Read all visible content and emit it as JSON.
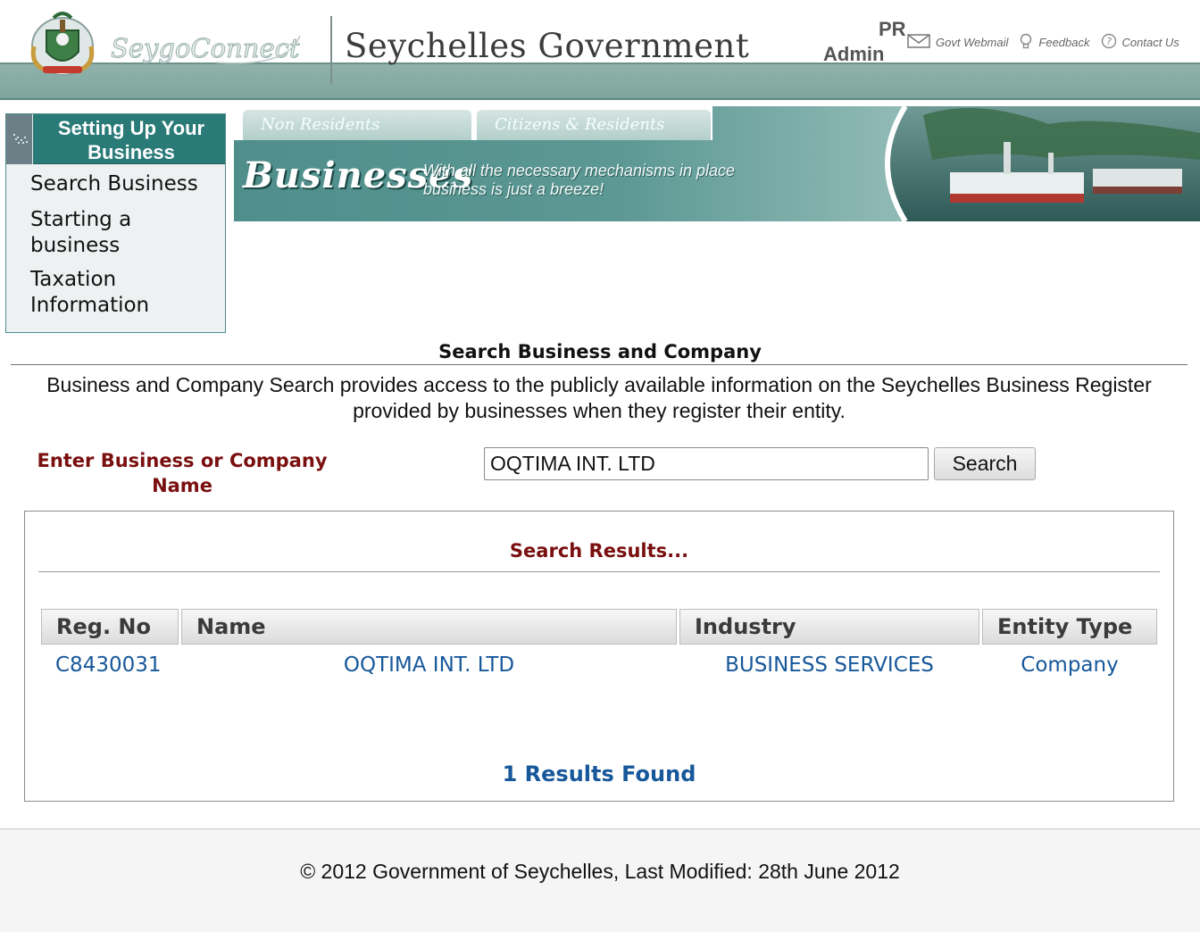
{
  "header": {
    "site_title": "Seychelles Government",
    "brand_logo": "SeygoConnect",
    "user_line1": "PR",
    "user_line2": "Admin",
    "links": [
      {
        "label": "Govt Webmail",
        "icon": "mail-icon"
      },
      {
        "label": "Feedback",
        "icon": "lightbulb-icon"
      },
      {
        "label": "Contact Us",
        "icon": "help-icon"
      }
    ]
  },
  "sidebar": {
    "title": "Setting Up Your Business",
    "items": [
      {
        "label": "Search Business"
      },
      {
        "label": "Starting a business"
      },
      {
        "label": "Taxation Information"
      }
    ]
  },
  "banner": {
    "tabs": [
      "Non Residents",
      "Citizens & Residents"
    ],
    "heading": "Businesses",
    "tagline": "With all the necessary mechanisms in place business is just a breeze!"
  },
  "main": {
    "section_title": "Search Business and Company",
    "intro": "Business and Company Search provides access to the publicly available information on the Seychelles Business Register provided by businesses when they register their entity.",
    "search": {
      "label": "Enter Business or Company Name",
      "value": "OQTIMA INT. LTD",
      "button_label": "Search"
    },
    "results": {
      "heading": "Search Results...",
      "columns": [
        "Reg. No",
        "Name",
        "Industry",
        "Entity Type"
      ],
      "rows": [
        {
          "reg_no": "C8430031",
          "name": "OQTIMA INT. LTD",
          "industry": "BUSINESS SERVICES",
          "entity_type": "Company"
        }
      ],
      "count_text": "1 Results Found"
    }
  },
  "footer": {
    "text": "© 2012 Government of Seychelles, Last Modified: 28th June 2012"
  },
  "colors": {
    "teal_accent": "#2a7a78",
    "header_band": "#8fb2aa",
    "label_maroon": "#7a0f0f",
    "link_blue": "#17589a"
  }
}
